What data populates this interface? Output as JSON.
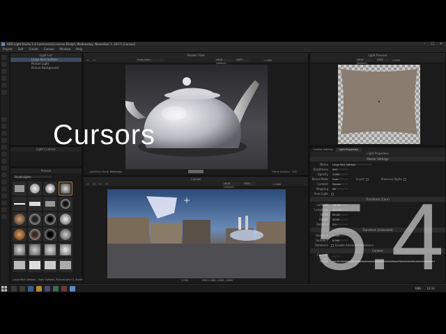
{
  "window": {
    "title": "HDR Light Studio 5.4 Commercial License [Dolph, Wednesday, November 1, 2017] [Canvas]"
  },
  "menu": [
    "Project",
    "Edit",
    "Create",
    "Canvas",
    "Window",
    "Help"
  ],
  "light_list": {
    "header": "Light List",
    "items": [
      {
        "label": "Large Rect Softbox",
        "selected": true
      },
      {
        "label": "Picture Light",
        "selected": false
      },
      {
        "label": "Picture Background",
        "selected": false
      }
    ]
  },
  "light_controls": {
    "header": "Light Controls"
  },
  "presets": {
    "header": "Presets",
    "category": "Studiolights",
    "status": "Large Rect Softbox - Tags: Softbox, PictureLight+4, Studio"
  },
  "render_view": {
    "header": "Render View",
    "camera": "front_view",
    "color_space": "sRGB (default)",
    "mode": "HDRI",
    "zoom": "1.0000",
    "light_paint_mode_label": "LightPaint Mode",
    "light_paint_mode": "Reflection",
    "frame_number_label": "Frame Number",
    "frame_number": "0.0"
  },
  "canvas": {
    "header": "Canvas",
    "color_space": "sRGB (default)",
    "mode": "HDRI",
    "zoom": "1.0000",
    "status_zoom": "1.000",
    "status_coords": "HSV: 0.000, 0.000, 0.000"
  },
  "light_preview": {
    "header": "Light Preview",
    "color_space": "sRGB (default)",
    "mode": "HDRI",
    "zoom": "1.0000"
  },
  "tabs": {
    "overlay_settings": "Overlay Settings",
    "light_properties": "Light Properties"
  },
  "properties": {
    "header": "Light Properties",
    "master_settings": "Master Settings",
    "name_label": "Name",
    "name_value": "Large Rect Softbox",
    "brightness_label": "Brightness",
    "brightness_value": "400",
    "opacity_label": "Opacity",
    "opacity_value": "1.000",
    "blend_mode_label": "Blend Mode",
    "blend_mode_value": "Over",
    "invert_label": "Invert",
    "preserve_alpha_label": "Preserve Alpha",
    "content_label": "Content",
    "content_value": "Square",
    "mapping_label": "Mapping",
    "mapping_value": "2D",
    "area_light_label": "Area Light",
    "transform_core": "Transform (Core)",
    "latitude_label": "Latitude",
    "latitude_value": "-31.39",
    "longitude_label": "Longitude",
    "longitude_value": "263.26",
    "width_label": "Width",
    "width_value": "20.00",
    "height_label": "Height",
    "height_value": "20.00",
    "rotation_label": "Rotation",
    "rotation_value": "0.0",
    "transform_extended": "Transform (Extended)",
    "handle_x_label": "Handle X",
    "handle_x_value": "0.000",
    "handle_y_label": "Handle Y",
    "handle_y_value": "0.000",
    "rotations_label": "Rotations",
    "enable_rotations_label": "Enable Advanced Rotations",
    "content_section": "Content",
    "content_type_label": "Content Type",
    "image_label": "Image",
    "image_value": "gentry/hlsdefault/studiolightpresets/TableCloths/Panel/Stretched/Studios/AreaLight-flat.tx"
  },
  "overlay": {
    "title": "Cursors",
    "version": "5.4"
  },
  "taskbar": {
    "time": "14:33",
    "lang": "ENG"
  }
}
